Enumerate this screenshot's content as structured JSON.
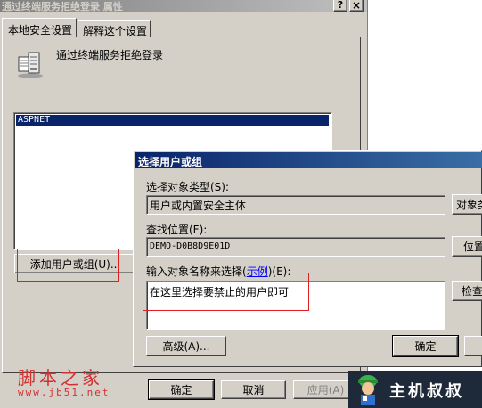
{
  "main_window": {
    "title": "通过终端服务拒绝登录 属性",
    "help_btn": "?",
    "close_btn": "×",
    "tabs": [
      {
        "label": "本地安全设置"
      },
      {
        "label": "解释这个设置"
      }
    ],
    "policy_name": "通过终端服务拒绝登录",
    "list_items": [
      "ASPNET"
    ],
    "add_button": "添加用户或组(U)...",
    "ok": "确定",
    "cancel": "取消",
    "apply": "应用(A)"
  },
  "dialog": {
    "title": "选择用户或组",
    "object_type_label": "选择对象类型(S):",
    "object_type_value": "用户或内置安全主体",
    "object_type_button": "对象类",
    "location_label": "查找位置(F):",
    "location_value": "DEMO-D0B8D9E01D",
    "location_button": "位置",
    "names_label_pre": "输入对象名称来选择(",
    "names_label_link": "示例",
    "names_label_post": ")(E):",
    "names_value": "在这里选择要禁止的用户即可",
    "check_button": "检查",
    "advanced_button": "高级(A)...",
    "ok": "确定"
  },
  "watermarks": {
    "left_title": "脚本之家",
    "left_url": "www.jb51.net",
    "right_text": "主机叔叔"
  },
  "colors": {
    "title_active": "#0a246a",
    "title_inactive": "#808080",
    "selection": "#0a246a",
    "highlight_box": "#e02020",
    "watermark_left": "#d03030",
    "watermark_right_bg": "#1e2a3a"
  }
}
